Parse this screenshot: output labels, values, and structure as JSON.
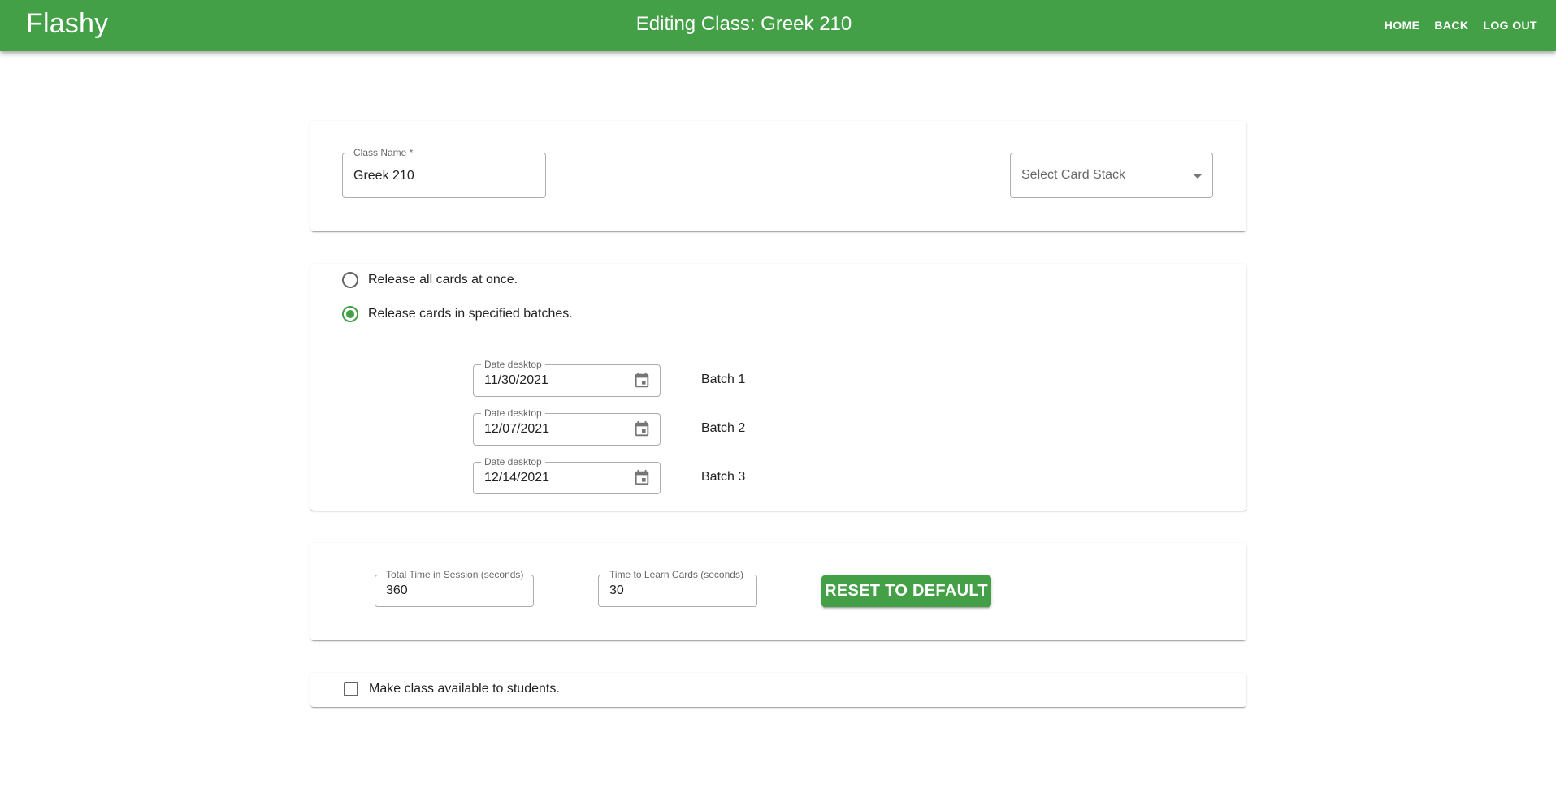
{
  "app": {
    "brand": "Flashy",
    "title": "Editing Class: Greek 210",
    "accent_color": "#43a047"
  },
  "nav": {
    "home": "HOME",
    "back": "BACK",
    "logout": "LOG OUT"
  },
  "class_info": {
    "class_name_label": "Class Name *",
    "class_name_value": "Greek 210",
    "card_stack_placeholder": "Select Card Stack",
    "card_stack_icon": "arrow-drop-down-icon"
  },
  "release": {
    "options": [
      {
        "label": "Release all cards at once.",
        "checked": false
      },
      {
        "label": "Release cards in specified batches.",
        "checked": true
      }
    ],
    "batches": [
      {
        "date_label": "Date desktop",
        "date": "11/30/2021",
        "name": "Batch 1",
        "icon": "calendar-icon"
      },
      {
        "date_label": "Date desktop",
        "date": "12/07/2021",
        "name": "Batch 2",
        "icon": "calendar-icon"
      },
      {
        "date_label": "Date desktop",
        "date": "12/14/2021",
        "name": "Batch 3",
        "icon": "calendar-icon"
      }
    ]
  },
  "timing": {
    "total_time_label": "Total Time in Session (seconds)",
    "total_time_value": "360",
    "learn_time_label": "Time to Learn Cards (seconds)",
    "learn_time_value": "30",
    "reset_label": "RESET TO DEFAULT"
  },
  "availability": {
    "label": "Make class available to students.",
    "checked": false
  }
}
